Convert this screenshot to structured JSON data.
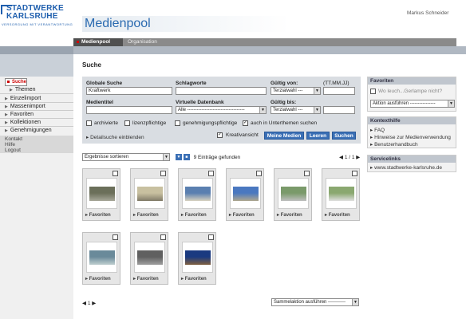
{
  "header": {
    "logo_line1": "STADTWERKE",
    "logo_line2": "KARLSRUHE",
    "logo_line3": "VERSORGUNG MIT VERANTWORTUNG",
    "app_title": "Medienpool",
    "user": "Markus Schneider"
  },
  "tabs": [
    {
      "label": "Medienpool"
    },
    {
      "label": "Organisation"
    }
  ],
  "nav": {
    "items": [
      {
        "label": "Suche"
      },
      {
        "label": "Themen"
      },
      {
        "label": "Einzelimport"
      },
      {
        "label": "Massenimport"
      },
      {
        "label": "Favoriten"
      },
      {
        "label": "Kollektionen"
      },
      {
        "label": "Genehmigungen"
      }
    ],
    "lower": [
      "Kontakt",
      "Hilfe",
      "Logout"
    ]
  },
  "page": {
    "title": "Suche"
  },
  "search": {
    "global_label": "Globale Suche",
    "global_value": "Kraftwerk",
    "keywords_label": "Schlagworte",
    "keywords_value": "",
    "valid_from_label": "Gültig von:",
    "valid_to_label": "Gültig bis:",
    "date_format": "(TT.MM.JJ)",
    "term_select": "Terzialwahl ---",
    "media_title_label": "Medientitel",
    "media_title_value": "",
    "virtual_db_label": "Virtuelle Datenbank",
    "virtual_db_value": "Alle ------------------------------------",
    "checkbox_archived": "archivierte",
    "checkbox_license": "lizenzpflichtige",
    "checkbox_approval": "genehmigungspflichtige",
    "checkbox_subthemes": "auch in Unterthemen suchen",
    "details_toggle": "Detailsuche einblenden",
    "checkbox_creative": "Kreativansicht",
    "btn_my_media": "Meine Medien",
    "btn_clear": "Leeren",
    "btn_search": "Suchen"
  },
  "results": {
    "sort_select": "Ergebnisse sortieren",
    "count_text": "9 Einträge gefunden",
    "page_info": "1 / 1",
    "favorites_label": "Favoriten",
    "collective_action": "Sammelaktion ausführen -----------",
    "bottom_pager": "1",
    "tiles": [
      {
        "icon": "industrial-photo"
      },
      {
        "icon": "chimney-photo"
      },
      {
        "icon": "building-photo"
      },
      {
        "icon": "tower-photo"
      },
      {
        "icon": "crowd-photo"
      },
      {
        "icon": "tent-photo"
      },
      {
        "icon": "event-photo"
      },
      {
        "icon": "interior-photo"
      },
      {
        "icon": "night-tower-photo"
      }
    ]
  },
  "sidebar_right": {
    "favorites": {
      "title": "Favoriten",
      "checkbox_label": "Wo leuch...Gerlampe nicht?",
      "action_select": "Aktion ausführen ----------------"
    },
    "context_help": {
      "title": "Kontexthilfe",
      "items": [
        "FAQ",
        "Hinweise zur Medienverwendung",
        "Benutzerhandbuch"
      ]
    },
    "service_links": {
      "title": "Servicelinks",
      "items": [
        "www.stadtwerke-karlsruhe.de"
      ]
    }
  },
  "colors": {
    "brand_blue": "#1f5fae",
    "button_blue": "#3a6fb5",
    "accent_red": "#cc0000"
  }
}
